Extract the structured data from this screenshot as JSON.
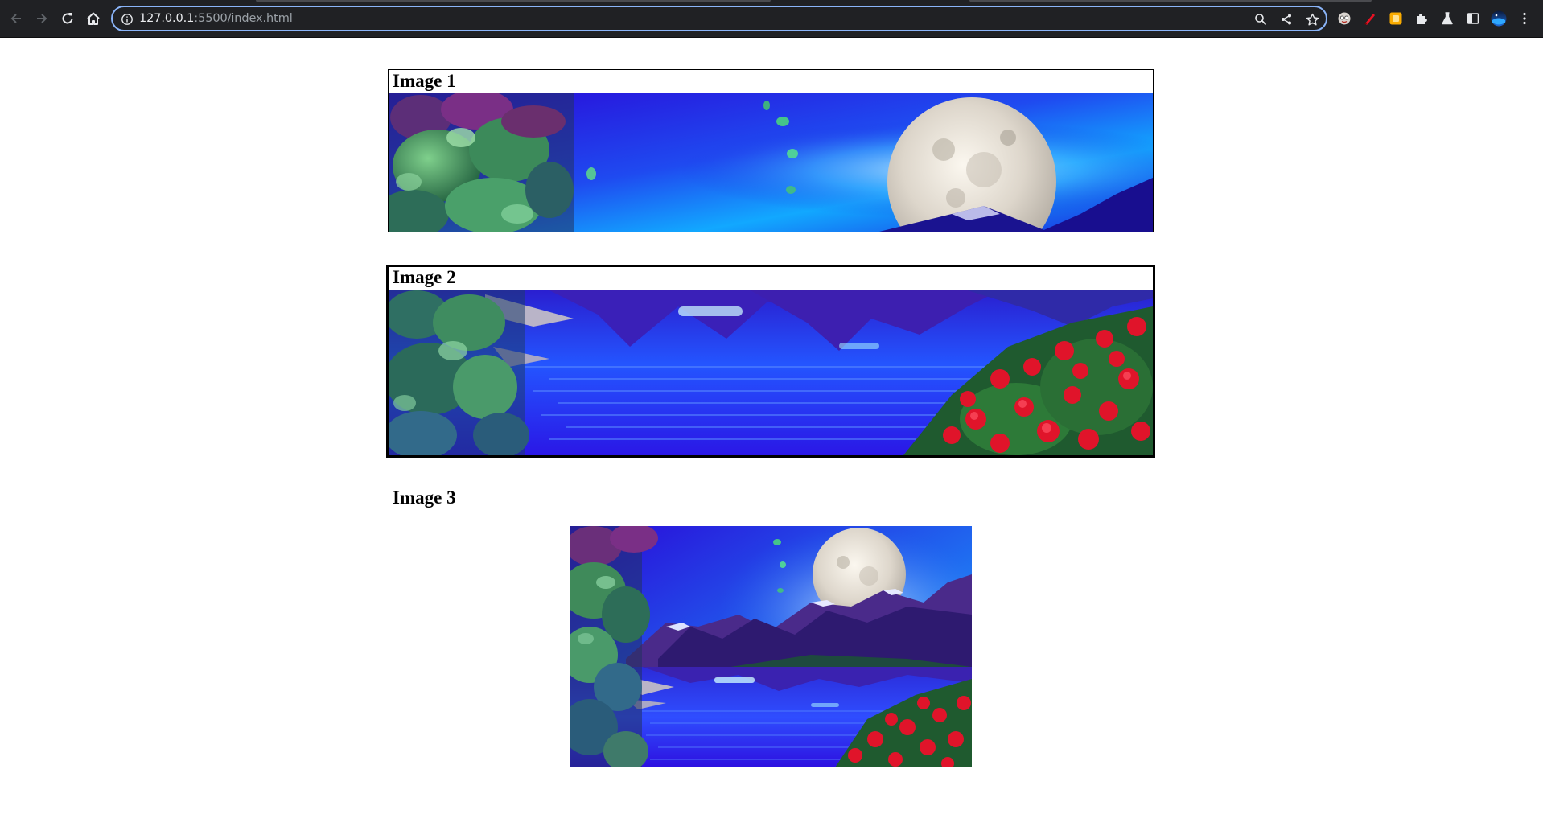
{
  "browser": {
    "url_host": "127.0.0.1",
    "url_rest": ":5500/index.html",
    "nav_icons": [
      "back-icon",
      "forward-icon",
      "reload-icon",
      "home-icon"
    ],
    "omnibox_icons": [
      "site-info-icon",
      "zoom-icon",
      "share-icon",
      "bookmark-star-icon"
    ],
    "extension_icons": [
      "extension-face-icon",
      "extension-red-icon",
      "extension-yellow-icon",
      "extensions-puzzle-icon",
      "labs-flask-icon",
      "side-panel-icon",
      "profile-avatar-icon",
      "menu-kebab-icon"
    ],
    "accent_color": "#8ab4f8"
  },
  "page": {
    "figures": [
      {
        "caption": "Image 1",
        "border": "1px"
      },
      {
        "caption": "Image 2",
        "border": "3px"
      },
      {
        "caption": "Image 3",
        "border": "none"
      }
    ]
  },
  "colors": {
    "sky_deep": "#1a0bd6",
    "sky_glow": "#12a8ff",
    "water": "#1f3bff",
    "foliage": "#2f7f4a",
    "roses": "#e0142a",
    "moon": "#e8e3da"
  }
}
